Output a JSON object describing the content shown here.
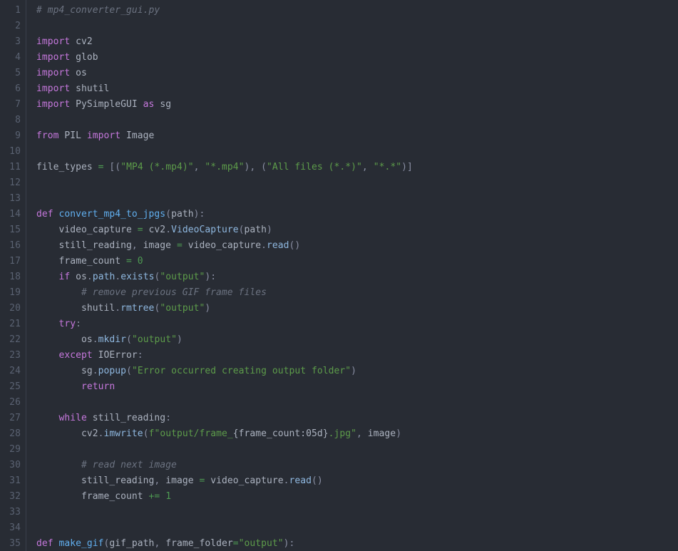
{
  "editor": {
    "theme_name": "one-dark",
    "language": "python",
    "background_color": "#282c34",
    "gutter_color": "#282c34",
    "line_number_color": "#5a6272",
    "first_visible_line": 1,
    "last_visible_line": 35,
    "total_visible_lines": 35,
    "palette": {
      "keyword": "#c678dd",
      "function": "#61afef",
      "method": "#8fb8e0",
      "identifier": "#abb2bf",
      "string": "#5d9c4a",
      "number": "#4e9a52",
      "operator": "#4e9a52",
      "punctuation": "#8a8fa3",
      "comment": "#6b7280"
    }
  },
  "line_numbers": [
    "1",
    "2",
    "3",
    "4",
    "5",
    "6",
    "7",
    "8",
    "9",
    "10",
    "11",
    "12",
    "13",
    "14",
    "15",
    "16",
    "17",
    "18",
    "19",
    "20",
    "21",
    "22",
    "23",
    "24",
    "25",
    "26",
    "27",
    "28",
    "29",
    "30",
    "31",
    "32",
    "33",
    "34",
    "35"
  ],
  "code_lines": [
    {
      "n": "1",
      "text": "# mp4_converter_gui.py",
      "tokens": [
        [
          "cmt",
          "# mp4_converter_gui.py"
        ]
      ]
    },
    {
      "n": "2",
      "text": "",
      "tokens": []
    },
    {
      "n": "3",
      "text": "import cv2",
      "tokens": [
        [
          "kw",
          "import"
        ],
        [
          "id",
          " cv2"
        ]
      ]
    },
    {
      "n": "4",
      "text": "import glob",
      "tokens": [
        [
          "kw",
          "import"
        ],
        [
          "id",
          " glob"
        ]
      ]
    },
    {
      "n": "5",
      "text": "import os",
      "tokens": [
        [
          "kw",
          "import"
        ],
        [
          "id",
          " os"
        ]
      ]
    },
    {
      "n": "6",
      "text": "import shutil",
      "tokens": [
        [
          "kw",
          "import"
        ],
        [
          "id",
          " shutil"
        ]
      ]
    },
    {
      "n": "7",
      "text": "import PySimpleGUI as sg",
      "tokens": [
        [
          "kw",
          "import"
        ],
        [
          "id",
          " PySimpleGUI "
        ],
        [
          "kw",
          "as"
        ],
        [
          "id",
          " sg"
        ]
      ]
    },
    {
      "n": "8",
      "text": "",
      "tokens": []
    },
    {
      "n": "9",
      "text": "from PIL import Image",
      "tokens": [
        [
          "kw",
          "from"
        ],
        [
          "id",
          " PIL "
        ],
        [
          "kw",
          "import"
        ],
        [
          "id",
          " Image"
        ]
      ]
    },
    {
      "n": "10",
      "text": "",
      "tokens": []
    },
    {
      "n": "11",
      "text": "file_types = [(\"MP4 (*.mp4)\", \"*.mp4\"), (\"All files (*.*)\", \"*.*\")]",
      "tokens": [
        [
          "id",
          "file_types "
        ],
        [
          "op",
          "="
        ],
        [
          "pun",
          " [("
        ],
        [
          "str",
          "\"MP4 (*.mp4)\""
        ],
        [
          "pun",
          ", "
        ],
        [
          "str",
          "\"*.mp4\""
        ],
        [
          "pun",
          "), ("
        ],
        [
          "str",
          "\"All files (*.*)\""
        ],
        [
          "pun",
          ", "
        ],
        [
          "str",
          "\"*.*\""
        ],
        [
          "pun",
          ")]"
        ]
      ]
    },
    {
      "n": "12",
      "text": "",
      "tokens": []
    },
    {
      "n": "13",
      "text": "",
      "tokens": []
    },
    {
      "n": "14",
      "text": "def convert_mp4_to_jpgs(path):",
      "tokens": [
        [
          "kw",
          "def"
        ],
        [
          "fn",
          " convert_mp4_to_jpgs"
        ],
        [
          "pun",
          "("
        ],
        [
          "id",
          "path"
        ],
        [
          "pun",
          "):"
        ]
      ]
    },
    {
      "n": "15",
      "text": "    video_capture = cv2.VideoCapture(path)",
      "tokens": [
        [
          "id",
          "    video_capture "
        ],
        [
          "op",
          "="
        ],
        [
          "id",
          " cv2"
        ],
        [
          "pun",
          "."
        ],
        [
          "mth",
          "VideoCapture"
        ],
        [
          "pun",
          "("
        ],
        [
          "id",
          "path"
        ],
        [
          "pun",
          ")"
        ]
      ]
    },
    {
      "n": "16",
      "text": "    still_reading, image = video_capture.read()",
      "tokens": [
        [
          "id",
          "    still_reading"
        ],
        [
          "pun",
          ", "
        ],
        [
          "id",
          "image "
        ],
        [
          "op",
          "="
        ],
        [
          "id",
          " video_capture"
        ],
        [
          "pun",
          "."
        ],
        [
          "mth",
          "read"
        ],
        [
          "pun",
          "()"
        ]
      ]
    },
    {
      "n": "17",
      "text": "    frame_count = 0",
      "tokens": [
        [
          "id",
          "    frame_count "
        ],
        [
          "op",
          "="
        ],
        [
          "num",
          " 0"
        ]
      ]
    },
    {
      "n": "18",
      "text": "    if os.path.exists(\"output\"):",
      "tokens": [
        [
          "id",
          "    "
        ],
        [
          "kw",
          "if"
        ],
        [
          "id",
          " os"
        ],
        [
          "pun",
          "."
        ],
        [
          "mth",
          "path"
        ],
        [
          "pun",
          "."
        ],
        [
          "mth",
          "exists"
        ],
        [
          "pun",
          "("
        ],
        [
          "str",
          "\"output\""
        ],
        [
          "pun",
          "):"
        ]
      ]
    },
    {
      "n": "19",
      "text": "        # remove previous GIF frame files",
      "tokens": [
        [
          "id",
          "        "
        ],
        [
          "cmt",
          "# remove previous GIF frame files"
        ]
      ]
    },
    {
      "n": "20",
      "text": "        shutil.rmtree(\"output\")",
      "tokens": [
        [
          "id",
          "        shutil"
        ],
        [
          "pun",
          "."
        ],
        [
          "mth",
          "rmtree"
        ],
        [
          "pun",
          "("
        ],
        [
          "str",
          "\"output\""
        ],
        [
          "pun",
          ")"
        ]
      ]
    },
    {
      "n": "21",
      "text": "    try:",
      "tokens": [
        [
          "id",
          "    "
        ],
        [
          "kw",
          "try"
        ],
        [
          "pun",
          ":"
        ]
      ]
    },
    {
      "n": "22",
      "text": "        os.mkdir(\"output\")",
      "tokens": [
        [
          "id",
          "        os"
        ],
        [
          "pun",
          "."
        ],
        [
          "mth",
          "mkdir"
        ],
        [
          "pun",
          "("
        ],
        [
          "str",
          "\"output\""
        ],
        [
          "pun",
          ")"
        ]
      ]
    },
    {
      "n": "23",
      "text": "    except IOError:",
      "tokens": [
        [
          "id",
          "    "
        ],
        [
          "kw",
          "except"
        ],
        [
          "cls",
          " IOError"
        ],
        [
          "pun",
          ":"
        ]
      ]
    },
    {
      "n": "24",
      "text": "        sg.popup(\"Error occurred creating output folder\")",
      "tokens": [
        [
          "id",
          "        sg"
        ],
        [
          "pun",
          "."
        ],
        [
          "mth",
          "popup"
        ],
        [
          "pun",
          "("
        ],
        [
          "str",
          "\"Error occurred creating output folder\""
        ],
        [
          "pun",
          ")"
        ]
      ]
    },
    {
      "n": "25",
      "text": "        return",
      "tokens": [
        [
          "id",
          "        "
        ],
        [
          "kw",
          "return"
        ]
      ]
    },
    {
      "n": "26",
      "text": "",
      "tokens": []
    },
    {
      "n": "27",
      "text": "    while still_reading:",
      "tokens": [
        [
          "id",
          "    "
        ],
        [
          "kw",
          "while"
        ],
        [
          "id",
          " still_reading"
        ],
        [
          "pun",
          ":"
        ]
      ]
    },
    {
      "n": "28",
      "text": "        cv2.imwrite(f\"output/frame_{frame_count:05d}.jpg\", image)",
      "tokens": [
        [
          "id",
          "        cv2"
        ],
        [
          "pun",
          "."
        ],
        [
          "mth",
          "imwrite"
        ],
        [
          "pun",
          "("
        ],
        [
          "str",
          "f\"output/frame_"
        ],
        [
          "fstr",
          "{frame_count:05d}"
        ],
        [
          "str",
          ".jpg\""
        ],
        [
          "pun",
          ", "
        ],
        [
          "id",
          "image"
        ],
        [
          "pun",
          ")"
        ]
      ]
    },
    {
      "n": "29",
      "text": "",
      "tokens": []
    },
    {
      "n": "30",
      "text": "        # read next image",
      "tokens": [
        [
          "id",
          "        "
        ],
        [
          "cmt",
          "# read next image"
        ]
      ]
    },
    {
      "n": "31",
      "text": "        still_reading, image = video_capture.read()",
      "tokens": [
        [
          "id",
          "        still_reading"
        ],
        [
          "pun",
          ", "
        ],
        [
          "id",
          "image "
        ],
        [
          "op",
          "="
        ],
        [
          "id",
          " video_capture"
        ],
        [
          "pun",
          "."
        ],
        [
          "mth",
          "read"
        ],
        [
          "pun",
          "()"
        ]
      ]
    },
    {
      "n": "32",
      "text": "        frame_count += 1",
      "tokens": [
        [
          "id",
          "        frame_count "
        ],
        [
          "op",
          "+="
        ],
        [
          "num",
          " 1"
        ]
      ]
    },
    {
      "n": "33",
      "text": "",
      "tokens": []
    },
    {
      "n": "34",
      "text": "",
      "tokens": []
    },
    {
      "n": "35",
      "text": "def make_gif(gif_path, frame_folder=\"output\"):",
      "tokens": [
        [
          "kw",
          "def"
        ],
        [
          "fn",
          " make_gif"
        ],
        [
          "pun",
          "("
        ],
        [
          "id",
          "gif_path"
        ],
        [
          "pun",
          ", "
        ],
        [
          "id",
          "frame_folder"
        ],
        [
          "op",
          "="
        ],
        [
          "str",
          "\"output\""
        ],
        [
          "pun",
          "):"
        ]
      ]
    }
  ]
}
